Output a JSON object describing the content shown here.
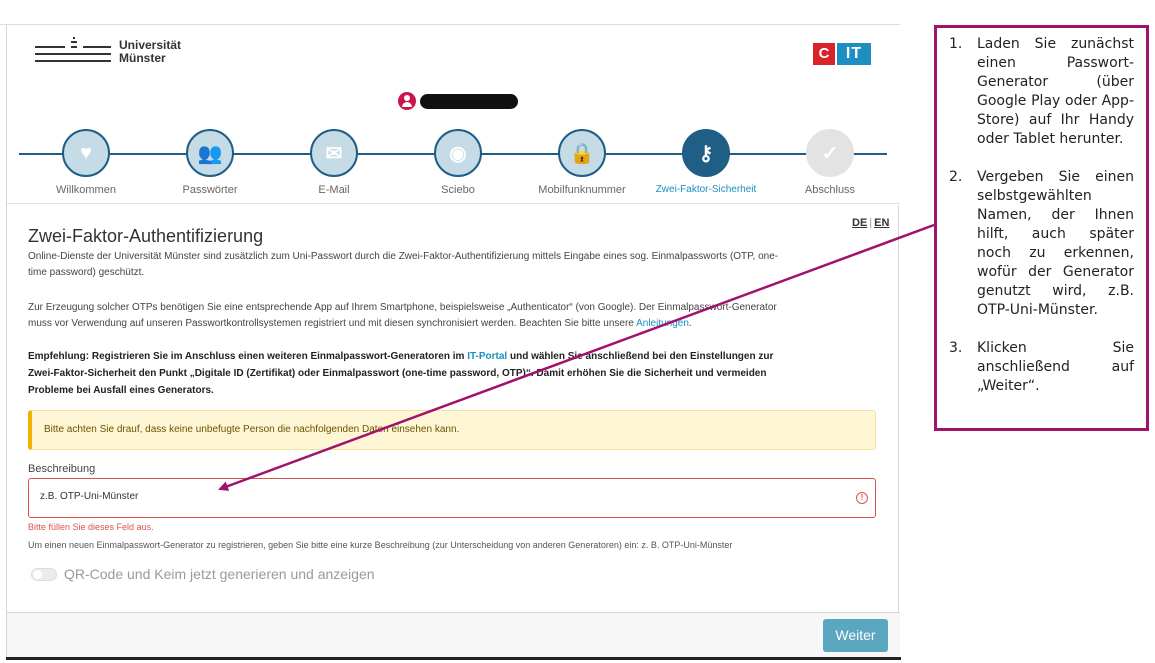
{
  "header": {
    "university_name_line1": "Universität",
    "university_name_line2": "Münster",
    "cit_logo_c": "C",
    "cit_logo_it": "IT"
  },
  "steps": [
    {
      "label": "Willkommen",
      "icon": "heart-icon",
      "glyph": "♥",
      "state": "done"
    },
    {
      "label": "Passwörter",
      "icon": "users-icon",
      "glyph": "👥",
      "state": "done"
    },
    {
      "label": "E-Mail",
      "icon": "envelope-icon",
      "glyph": "✉",
      "state": "done"
    },
    {
      "label": "Sciebo",
      "icon": "cloud-icon",
      "glyph": "◉",
      "state": "done"
    },
    {
      "label": "Mobilfunknummer",
      "icon": "lock-icon",
      "glyph": "🔒",
      "state": "done"
    },
    {
      "label": "Zwei-Faktor-Sicherheit",
      "icon": "key-icon",
      "glyph": "⚷",
      "state": "active"
    },
    {
      "label": "Abschluss",
      "icon": "check-icon",
      "glyph": "✓",
      "state": "pending"
    }
  ],
  "lang": {
    "de": "DE",
    "en": "EN"
  },
  "main": {
    "title": "Zwei-Faktor-Authentifizierung",
    "intro_line1": "Online-Dienste der Universität Münster sind zusätzlich zum Uni-Passwort durch die Zwei-Faktor-Authentifizierung mittels Eingabe eines sog. Einmalpassworts (OTP, one-",
    "intro_line2": "time password) geschützt.",
    "para2_line1": "Zur Erzeugung solcher OTPs benötigen Sie eine entsprechende App auf Ihrem Smartphone, beispielsweise „Authenticator“ (von Google). Der Einmalpasswort-Generator",
    "para2_line2_pre": "muss vor Verwendung auf unseren Passwortkontrollsystemen registriert und mit diesen synchronisiert werden. Beachten Sie bitte unsere ",
    "para2_link": "Anleitungen",
    "para2_line2_post": ".",
    "rec_line1_pre": "Empfehlung: Registrieren Sie im Anschluss einen weiteren Einmalpasswort-Generatoren im ",
    "rec_link": "IT-Portal",
    "rec_line1_post": " und wählen Sie anschließend bei den Einstellungen zur",
    "rec_line2": "Zwei-Faktor-Sicherheit den Punkt „Digitale ID (Zertifikat) oder Einmalpasswort (one-time password, OTP)“. Damit erhöhen Sie die Sicherheit und vermeiden",
    "rec_line3": "Probleme bei Ausfall eines Generators.",
    "alert": "Bitte achten Sie drauf, dass keine unbefugte Person die nachfolgenden Daten einsehen kann.",
    "field_label": "Beschreibung",
    "field_value": "z.B. OTP-Uni-Münster",
    "error_text": "Bitte füllen Sie dieses Feld aus.",
    "help_text": "Um einen neuen Einmalpasswort-Generator zu registrieren, geben Sie bitte eine kurze Beschreibung (zur Unterscheidung von anderen Generatoren) ein: z. B. OTP-Uni-Münster",
    "toggle_label": "QR-Code und Keim jetzt generieren und anzeigen",
    "next_button": "Weiter"
  },
  "annotation": {
    "items": [
      {
        "num": "1.",
        "text": "Laden Sie zunächst einen Passwort-Generator (über Google Play oder App-Store) auf Ihr Handy oder Tablet herunter."
      },
      {
        "num": "2.",
        "text": "Vergeben Sie einen selbstgewählten Namen, der Ihnen hilft, auch später noch zu erkennen, wofür der Generator genutzt wird, z.B. OTP-Uni-Münster."
      },
      {
        "num": "3.",
        "text": "Klicken Sie anschließend auf „Weiter“."
      }
    ],
    "color": "#a1136b"
  },
  "colors": {
    "primary": "#1f5f86",
    "accent": "#1d8ec0",
    "error": "#d9534f",
    "button": "#5aa7bf"
  }
}
